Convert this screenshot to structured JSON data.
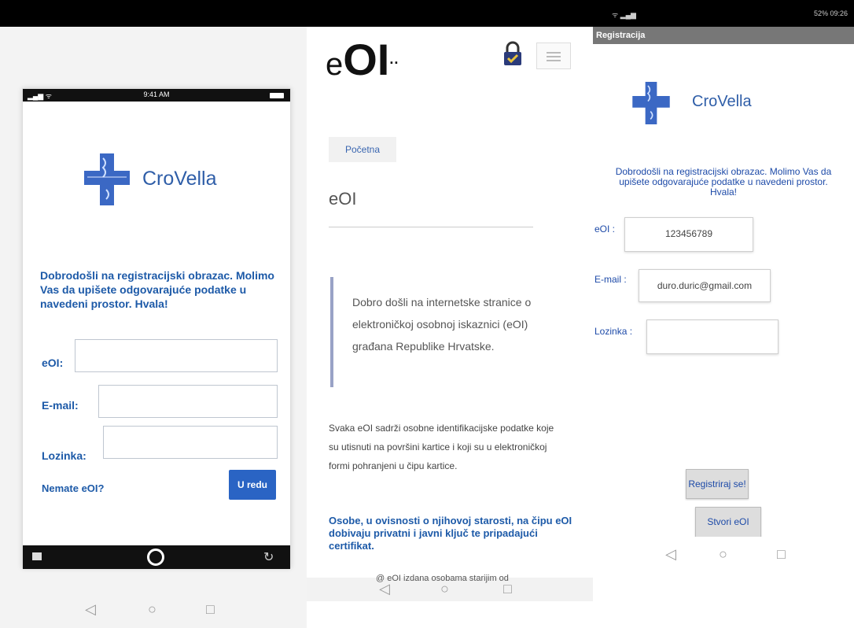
{
  "panel1": {
    "status_time": "9:41 AM",
    "logo_text": "CroVella",
    "welcome": "Dobrodošli na registracijski obrazac. Molimo Vas da upišete odgovarajuće podatke u navedeni prostor. Hvala!",
    "eoi_label": "eOI:",
    "email_label": "E-mail:",
    "password_label": "Lozinka:",
    "no_eoi_link": "Nemate eOI?",
    "ok_button": "U redu"
  },
  "panel2": {
    "logo_text": "OI",
    "logo_e": "e",
    "breadcrumb": "Početna",
    "page_title": "eOI",
    "quote": "Dobro došli na internetske stranice o elektroničkoj osobnoj iskaznici (eOI) građana Republike Hrvatske.",
    "body": "Svaka eOI sadrži osobne identifikacijske podatke koje su utisnuti na površini kartice i koji su u elektroničkoj formi pohranjeni u čipu kartice.",
    "bold": "Osobe, u ovisnosti o njihovoj starosti, na čipu eOI dobivaju privatni i javni ključ te pripadajući certifikat.",
    "cut_text": "@ eOI izdana osobama starijim od"
  },
  "panel3": {
    "status_right": "52% 09:26",
    "header": "Registracija",
    "logo_text": "CroVella",
    "welcome": "Dobrodošli na registracijski obrazac. Molimo Vas da upišete odgovarajuće podatke u navedeni prostor. Hvala!",
    "eoi_label": "eOI :",
    "eoi_value": "123456789",
    "email_label": "E-mail :",
    "email_value": "duro.duric@gmail.com",
    "password_label": "Lozinka :",
    "password_value": "",
    "register_button": "Registriraj se!",
    "create_button": "Stvori eOI"
  },
  "colors": {
    "brand_blue": "#2a64c4",
    "text_blue": "#1d5aa8"
  }
}
